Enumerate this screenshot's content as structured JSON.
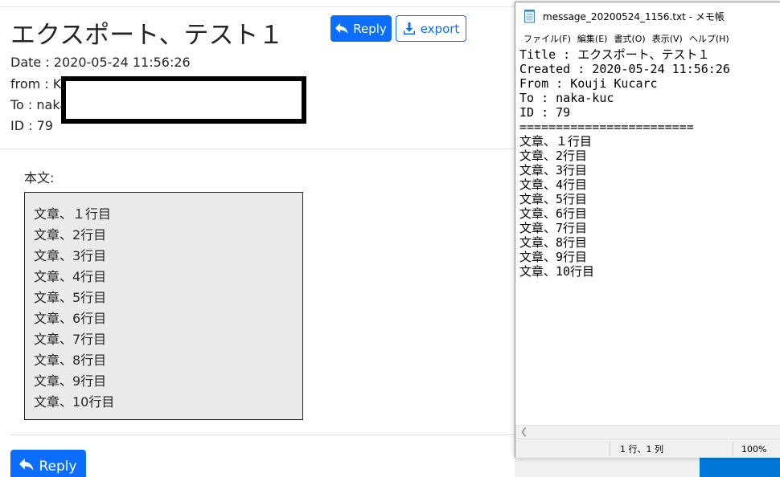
{
  "message": {
    "title": "エクスポート、テスト１",
    "reply_label": "Reply",
    "export_label": "export",
    "date_text": "Date : 2020-05-24 11:56:26",
    "from_text": "from : K",
    "to_text": "To : naka",
    "id_text": "ID : 79",
    "body_label": "本文:",
    "body_lines": [
      "文章、１行目",
      "文章、2行目",
      "文章、3行目",
      "文章、4行目",
      "文章、5行目",
      "文章、6行目",
      "文章、7行目",
      "文章、8行目",
      "文章、9行目",
      "文章、10行目"
    ],
    "reply_bottom_label": "Reply"
  },
  "notepad": {
    "window_title": "message_20200524_1156.txt - メモ帳",
    "menu": [
      "ファイル(F)",
      "編集(E)",
      "書式(O)",
      "表示(V)",
      "ヘルプ(H)"
    ],
    "lines": [
      "Title : エクスポート、テスト１",
      "Created : 2020-05-24 11:56:26",
      "From : Kouji Kucarc",
      "To : naka-kuc",
      "ID : 79",
      "========================",
      "文章、１行目",
      "文章、2行目",
      "文章、3行目",
      "文章、4行目",
      "文章、5行目",
      "文章、6行目",
      "文章、7行目",
      "文章、8行目",
      "文章、9行目",
      "文章、10行目"
    ],
    "status_position": "1 行、1 列",
    "status_zoom": "100%"
  },
  "icons": {
    "reply": "reply-arrow-icon",
    "export": "download-icon",
    "notepad": "notepad-file-icon",
    "scroll_left": "chevron-left-icon"
  },
  "colors": {
    "primary": "#0d6efd",
    "body_box": "#ebebeb",
    "taskbar": "#0078d7"
  }
}
